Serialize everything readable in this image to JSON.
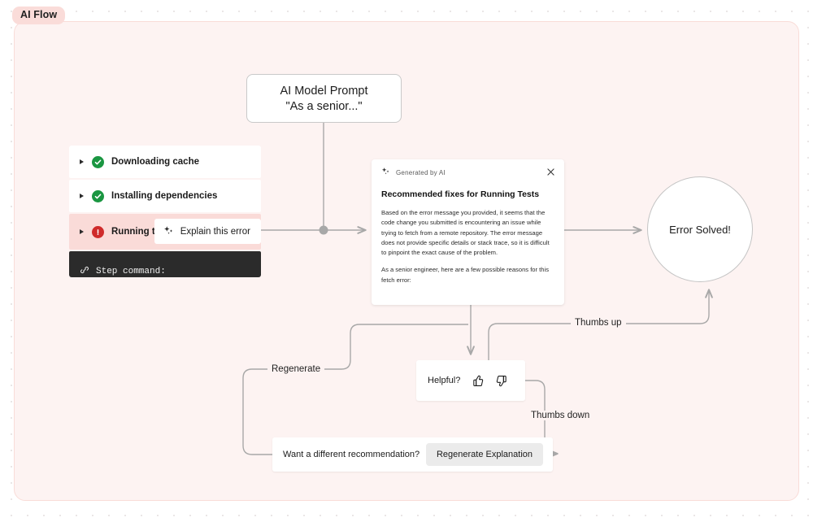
{
  "group": {
    "badge": "AI Flow"
  },
  "nodes": {
    "prompt": {
      "title": "AI Model Prompt",
      "subtitle": "\"As a senior...\""
    },
    "steps": [
      {
        "label": "Downloading cache",
        "status": "success",
        "icon": "check-circle-icon"
      },
      {
        "label": "Installing dependencies",
        "status": "success",
        "icon": "check-circle-icon"
      },
      {
        "label": "Running tests",
        "status": "error",
        "icon": "error-circle-icon",
        "action_label": "Explain this error",
        "action_icon": "sparkle-icon"
      }
    ],
    "terminal": {
      "icon": "link-icon",
      "text": "Step command:"
    },
    "ai_panel": {
      "header_label": "Generated by AI",
      "header_icon": "sparkle-icon",
      "close_icon": "close-icon",
      "title_prefix": "Recommended fixes for ",
      "title_subject": "Running Tests",
      "paragraphs": [
        "Based on the error message you provided, it seems that the code change you submitted is encountering an issue while trying to fetch from a remote repository. The error message does not provide specific details or stack trace, so it is difficult to pinpoint the exact cause of the problem.",
        "As a senior engineer, here are a few possible reasons for this fetch error:"
      ]
    },
    "solved": {
      "label": "Error Solved!"
    },
    "helpful": {
      "label": "Helpful?",
      "thumbs_up_icon": "thumbs-up-icon",
      "thumbs_down_icon": "thumbs-down-icon"
    },
    "regenerate": {
      "label": "Want a different recommendation?",
      "button_label": "Regenerate Explanation"
    }
  },
  "edges": {
    "thumbs_up": "Thumbs up",
    "thumbs_down": "Thumbs down",
    "regenerate": "Regenerate"
  },
  "colors": {
    "group_bg": "#fdf3f2",
    "group_border": "#f9dcd8",
    "badge_bg": "#fadcd9",
    "error_row_bg": "#fadbd8",
    "success": "#1a9641",
    "error": "#cf2b2b",
    "edge": "#a8a8a8",
    "terminal_bg": "#2b2b2b"
  }
}
